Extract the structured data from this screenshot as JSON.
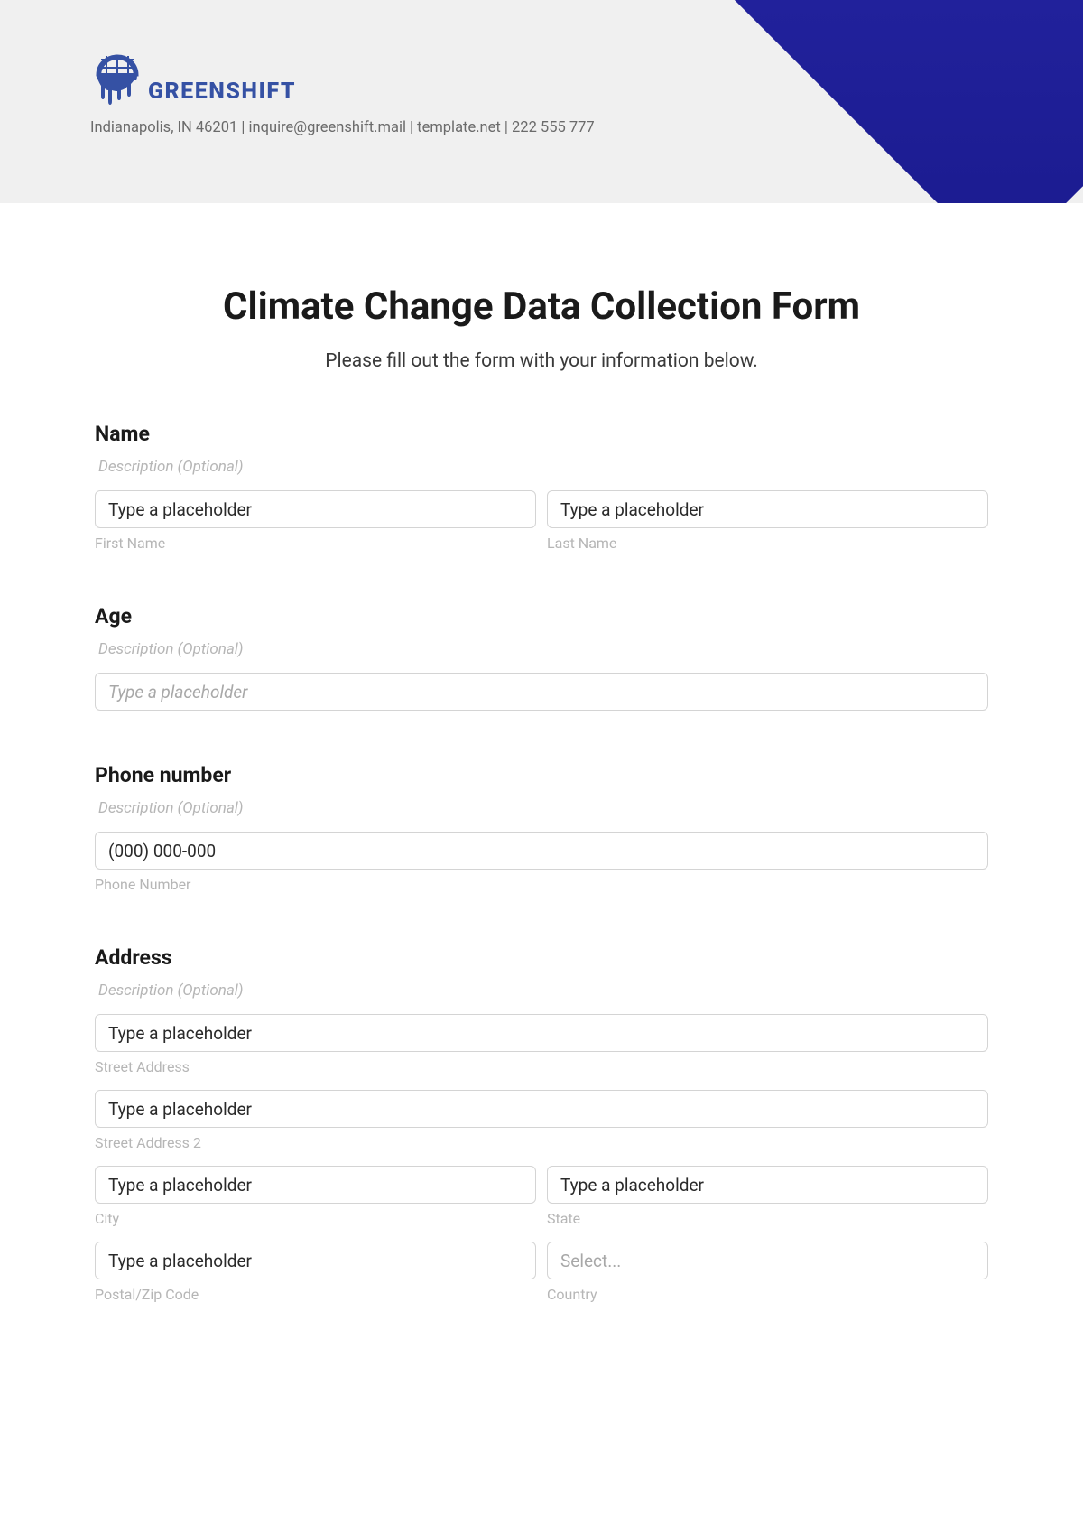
{
  "company": {
    "name": "GREENSHIFT",
    "contact": "Indianapolis, IN 46201 | inquire@greenshift.mail | template.net | 222 555 777"
  },
  "form": {
    "title": "Climate Change Data Collection Form",
    "subtitle": "Please fill out the form with your information below.",
    "description_optional": "Description (Optional)",
    "sections": {
      "name": {
        "label": "Name",
        "first_name_placeholder": "Type a placeholder",
        "first_name_sublabel": "First Name",
        "last_name_placeholder": "Type a placeholder",
        "last_name_sublabel": "Last Name"
      },
      "age": {
        "label": "Age",
        "placeholder": "Type a placeholder"
      },
      "phone": {
        "label": "Phone number",
        "placeholder": "(000) 000-000",
        "sublabel": "Phone Number"
      },
      "address": {
        "label": "Address",
        "street1_placeholder": "Type a placeholder",
        "street1_sublabel": "Street Address",
        "street2_placeholder": "Type a placeholder",
        "street2_sublabel": "Street Address 2",
        "city_placeholder": "Type a placeholder",
        "city_sublabel": "City",
        "state_placeholder": "Type a placeholder",
        "state_sublabel": "State",
        "postal_placeholder": "Type a placeholder",
        "postal_sublabel": "Postal/Zip Code",
        "country_placeholder": "Select...",
        "country_sublabel": "Country"
      }
    }
  }
}
